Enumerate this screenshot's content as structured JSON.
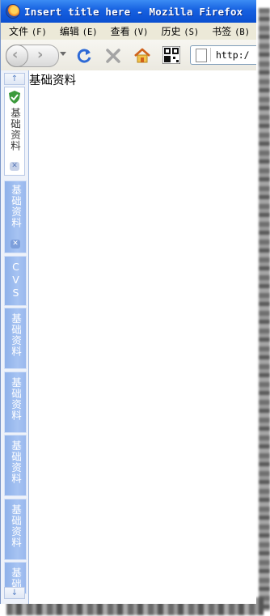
{
  "window": {
    "title": "Insert title here - Mozilla Firefox"
  },
  "menubar": {
    "items": [
      {
        "label": "文件",
        "accel": "(F)"
      },
      {
        "label": "编辑",
        "accel": "(E)"
      },
      {
        "label": "查看",
        "accel": "(V)"
      },
      {
        "label": "历史",
        "accel": "(S)"
      },
      {
        "label": "书签",
        "accel": "(B)"
      }
    ]
  },
  "toolbar": {
    "back_icon": "back-arrow-icon",
    "forward_icon": "forward-arrow-icon",
    "reload_icon": "reload-icon",
    "stop_icon": "stop-icon",
    "home_icon": "home-icon",
    "addon_icon": "qr-grid-icon",
    "url_text": "http:/"
  },
  "sidebar": {
    "active_panel": {
      "label": "基础资料",
      "icon": "shield-check-icon"
    },
    "tabs": [
      {
        "label": "基础资料"
      },
      {
        "label": "CVS"
      },
      {
        "label": "基础资料"
      },
      {
        "label": "基础资料"
      },
      {
        "label": "基础资料"
      },
      {
        "label": "基础资料"
      },
      {
        "label": "基础资料"
      }
    ],
    "scroll_up": "↑",
    "scroll_down": "↓",
    "close_glyph": "✕"
  },
  "content": {
    "text": "基础资料"
  },
  "colors": {
    "titlebar": "#0a4fd0",
    "tab_blue": "#a6c3f2",
    "menubar": "#ece9d8"
  }
}
